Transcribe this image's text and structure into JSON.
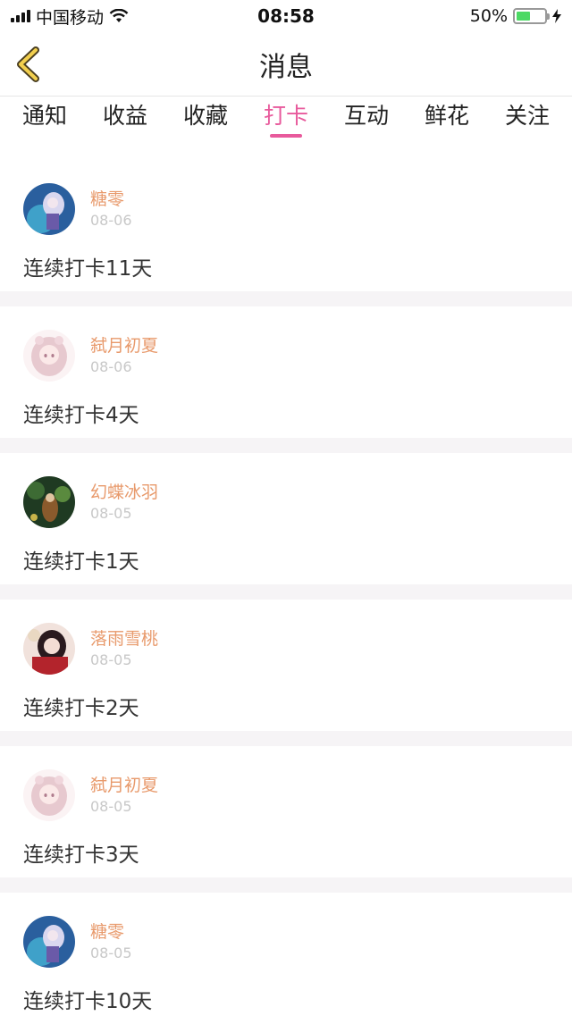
{
  "status_bar": {
    "carrier": "中国移动",
    "time": "08:58",
    "battery_percent": "50%",
    "battery_level": 0.5
  },
  "nav": {
    "back_icon": "chevron-left-icon",
    "title": "消息"
  },
  "tabs": [
    {
      "label": "通知",
      "active": false
    },
    {
      "label": "收益",
      "active": false
    },
    {
      "label": "收藏",
      "active": false
    },
    {
      "label": "打卡",
      "active": true
    },
    {
      "label": "互动",
      "active": false
    },
    {
      "label": "鲜花",
      "active": false
    },
    {
      "label": "关注",
      "active": false
    }
  ],
  "colors": {
    "accent": "#e85a9c",
    "username": "#e89a6c",
    "date": "#c8c8c8"
  },
  "items": [
    {
      "name": "糖零",
      "date": "08-06",
      "message": "连续打卡11天"
    },
    {
      "name": "弑月初夏",
      "date": "08-06",
      "message": "连续打卡4天"
    },
    {
      "name": "幻蝶冰羽",
      "date": "08-05",
      "message": "连续打卡1天"
    },
    {
      "name": "落雨雪桃",
      "date": "08-05",
      "message": "连续打卡2天"
    },
    {
      "name": "弑月初夏",
      "date": "08-05",
      "message": "连续打卡3天"
    },
    {
      "name": "糖零",
      "date": "08-05",
      "message": "连续打卡10天"
    }
  ]
}
